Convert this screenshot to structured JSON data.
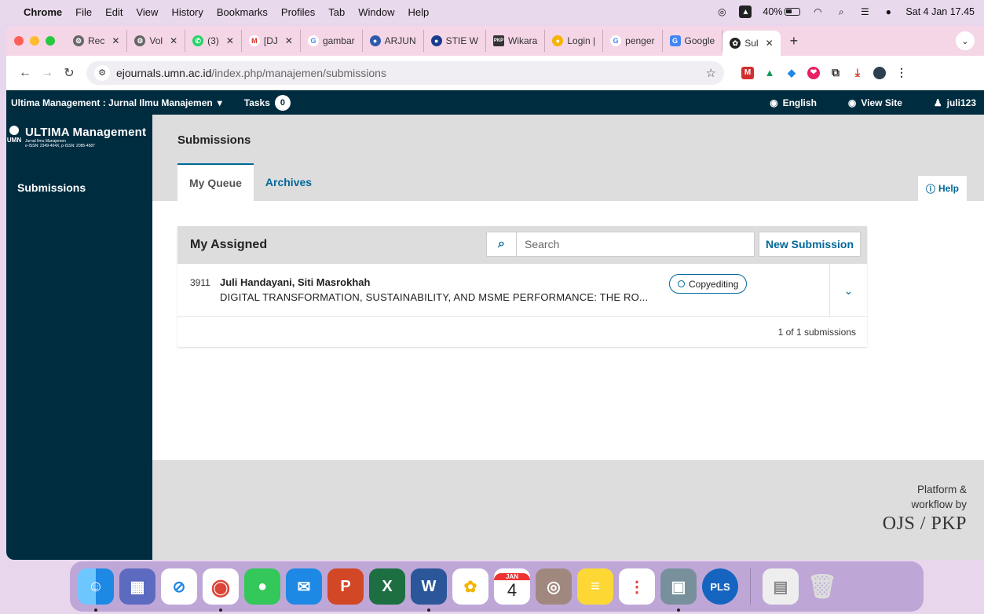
{
  "menubar": {
    "app": "Chrome",
    "items": [
      "File",
      "Edit",
      "View",
      "History",
      "Bookmarks",
      "Profiles",
      "Tab",
      "Window",
      "Help"
    ],
    "battery": "40%",
    "datetime": "Sat 4 Jan 17.45"
  },
  "browser": {
    "tabs": [
      {
        "label": "Rec",
        "color": "#555"
      },
      {
        "label": "Vol",
        "color": "#555"
      },
      {
        "label": "(3)",
        "color": "#25d366"
      },
      {
        "label": "[DJ",
        "color": "#d93025"
      },
      {
        "label": "gambar",
        "color": "#4285f4"
      },
      {
        "label": "ARJUN",
        "color": "#2e5aac"
      },
      {
        "label": "STIE W",
        "color": "#1a3c8c"
      },
      {
        "label": "Wikara",
        "color": "#333"
      },
      {
        "label": "Login |",
        "color": "#f4b400"
      },
      {
        "label": "penger",
        "color": "#4285f4"
      },
      {
        "label": "Google",
        "color": "#4285f4"
      }
    ],
    "active_tab": "Sul",
    "url_host": "ejournals.umn.ac.id",
    "url_path": "/index.php/manajemen/submissions"
  },
  "ojs": {
    "journal_name": "Ultima Management : Jurnal Ilmu Manajemen",
    "tasks_label": "Tasks",
    "tasks_count": "0",
    "language": "English",
    "view_site": "View Site",
    "username": "juli123",
    "logo": {
      "mark": "UMN",
      "name": "ULTIMA Management",
      "sub1": "Jurnal Ilmu Manajemen",
      "sub2": "e-ISSN: 2349-404X, p-ISSN: 2085-4587"
    },
    "sidebar_item": "Submissions",
    "page_title": "Submissions",
    "tabs": [
      "My Queue",
      "Archives"
    ],
    "help": "Help",
    "panel_title": "My Assigned",
    "search_placeholder": "Search",
    "new_submission": "New Submission",
    "submission": {
      "id": "3911",
      "authors": "Juli Handayani, Siti Masrokhah",
      "title": "DIGITAL TRANSFORMATION, SUSTAINABILITY, AND MSME PERFORMANCE: THE RO...",
      "stage": "Copyediting"
    },
    "count_text": "1 of 1 submissions",
    "footer": {
      "line1": "Platform &",
      "line2": "workflow by",
      "brand": "OJS / PKP"
    }
  },
  "dock": {
    "calendar_month": "JAN",
    "calendar_day": "4",
    "pls_label": "PLS"
  }
}
